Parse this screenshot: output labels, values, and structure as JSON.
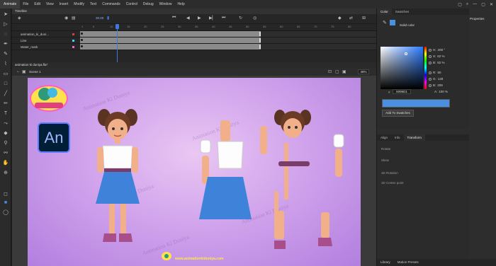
{
  "menubar": {
    "app_name": "Animate",
    "items": [
      "File",
      "Edit",
      "View",
      "Insert",
      "Modify",
      "Text",
      "Commands",
      "Control",
      "Debug",
      "Window",
      "Help"
    ]
  },
  "timeline": {
    "tab": "Timeline",
    "fps": "30.00",
    "ruler": [
      "1",
      "5",
      "10",
      "15",
      "20",
      "25",
      "30",
      "35",
      "40",
      "45",
      "50",
      "55",
      "60",
      "65",
      "70",
      "75",
      "80"
    ],
    "layers": [
      {
        "name": "animation_ki_duni...",
        "color": "#e23a3a"
      },
      {
        "name": "Line",
        "color": "#3ad6ff"
      },
      {
        "name": "Water_mark",
        "color": "#ff5ccf"
      }
    ]
  },
  "document": {
    "tab": "animation ki duniya.fla*",
    "scene": "Scene 1",
    "zoom": "48%"
  },
  "stage": {
    "logo_text": "An",
    "watermark": "Animation Ki Duniya",
    "footer_url": "www.animationkiduniya.com",
    "accent_colors": {
      "skirt": "#3f82d9",
      "bg": "#c393e8"
    }
  },
  "color_panel": {
    "tabs": [
      "Color",
      "Swatches"
    ],
    "fill_type": "Solid color",
    "hsb": [
      {
        "label": "H:",
        "value": "208 °"
      },
      {
        "label": "S:",
        "value": "62 %"
      },
      {
        "label": "B:",
        "value": "82 %"
      }
    ],
    "rgb": [
      {
        "label": "R:",
        "value": "80"
      },
      {
        "label": "G:",
        "value": "149"
      },
      {
        "label": "B:",
        "value": "209"
      }
    ],
    "alpha": {
      "label": "A:",
      "value": "100 %"
    },
    "hex_label": "#",
    "hex": "5095D1",
    "swatch_color": "#5095d1",
    "add_button": "Add To Swatches"
  },
  "right_panel": {
    "properties_tab": "Properties",
    "transform_tabs": [
      "Align",
      "Info",
      "Transform"
    ],
    "transform_rows": [
      "Rotate",
      "Skew",
      "3D Rotation",
      "3D Center point"
    ],
    "library_tabs": [
      "Library",
      "Motion Presets"
    ]
  }
}
